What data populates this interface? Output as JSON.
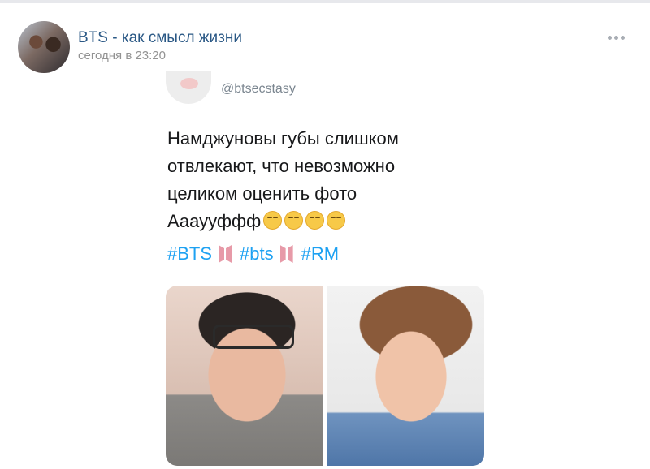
{
  "post": {
    "page_name": "BTS - как смысл жизни",
    "time": "сегодня в 23:20",
    "more_icon": "more-horizontal-icon"
  },
  "tweet": {
    "handle": "@btsecstasy",
    "lines": [
      "Намджуновы губы слишком",
      "отвлекают, что невозможно",
      "целиком оценить фото",
      "Аааууффф"
    ],
    "emoji_count": 4,
    "emoji_name": "smirking-face-emoji",
    "hashtags": [
      "#BTS",
      "#bts",
      "#RM"
    ],
    "hashtag_color": "#1da1f2",
    "logo_color": "#e79aa8"
  },
  "colors": {
    "page_name": "#2a5885",
    "meta": "#939393",
    "text": "#17181a"
  }
}
